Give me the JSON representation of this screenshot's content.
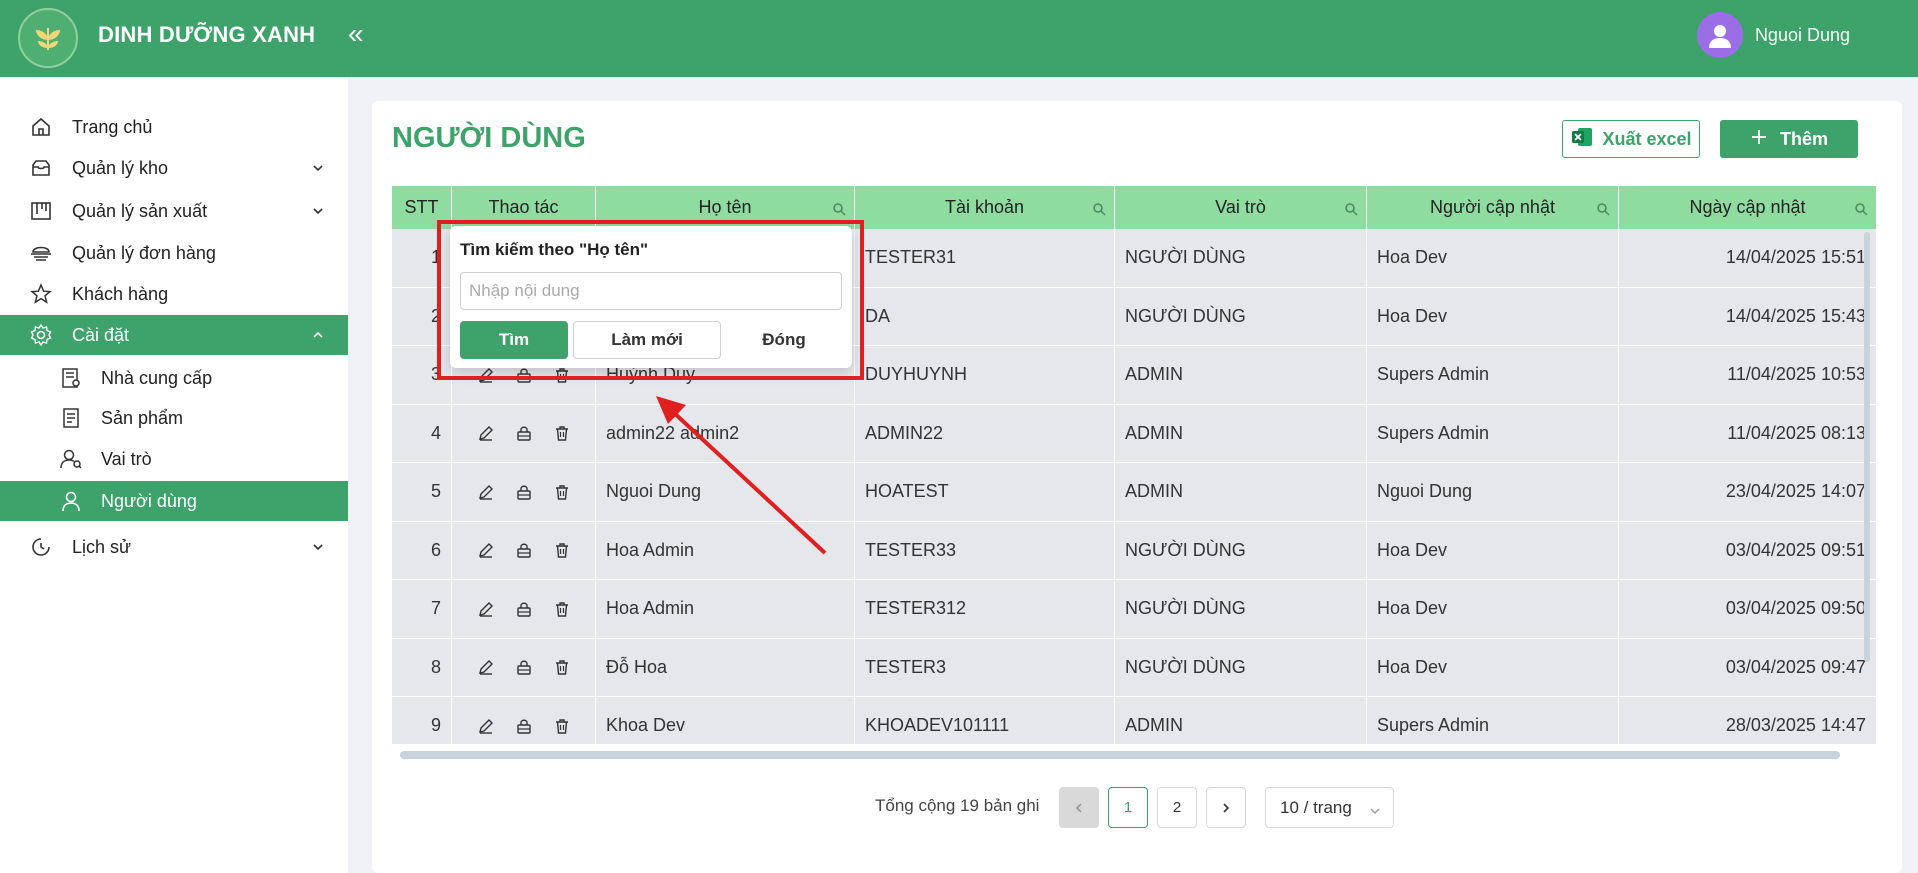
{
  "header": {
    "brand": "DINH DƯỠNG XANH",
    "collapse_icon": "double-chevron-left",
    "user_name": "Nguoi Dung",
    "colors": {
      "primary": "#3da36a",
      "avatar": "#9b6ee8"
    }
  },
  "sidebar": {
    "items": [
      {
        "label": "Trang chủ",
        "icon": "home-icon"
      },
      {
        "label": "Quản lý kho",
        "icon": "inbox-icon",
        "expandable": true
      },
      {
        "label": "Quản lý sản xuất",
        "icon": "factory-icon",
        "expandable": true
      },
      {
        "label": "Quản lý đơn hàng",
        "icon": "order-icon"
      },
      {
        "label": "Khách hàng",
        "icon": "star-icon"
      },
      {
        "label": "Cài đặt",
        "icon": "gear-icon",
        "expanded": true,
        "active": true
      },
      {
        "label": "Nhà cung cấp",
        "icon": "supplier-icon",
        "sub": true
      },
      {
        "label": "Sản phẩm",
        "icon": "product-icon",
        "sub": true
      },
      {
        "label": "Vai trò",
        "icon": "roles-icon",
        "sub": true
      },
      {
        "label": "Người dùng",
        "icon": "user-icon",
        "sub": true,
        "active": true
      },
      {
        "label": "Lịch sử",
        "icon": "history-icon",
        "expandable": true
      }
    ]
  },
  "main": {
    "title": "NGƯỜI DÙNG",
    "export_label": "Xuất excel",
    "add_label": "Thêm"
  },
  "table": {
    "columns": [
      "STT",
      "Thao tác",
      "Họ tên",
      "Tài khoản",
      "Vai trò",
      "Người cập nhật",
      "Ngày cập nhật"
    ],
    "rows": [
      {
        "stt": "1",
        "name": "",
        "account": "TESTER31",
        "role": "NGƯỜI DÙNG",
        "updated_by": "Hoa Dev",
        "updated_at": "14/04/2025 15:51"
      },
      {
        "stt": "2",
        "name": "",
        "account": "DA",
        "role": "NGƯỜI DÙNG",
        "updated_by": "Hoa Dev",
        "updated_at": "14/04/2025 15:43"
      },
      {
        "stt": "3",
        "name": "Huỳnh Duy",
        "account": "DUYHUYNH",
        "role": "ADMIN",
        "updated_by": "Supers Admin",
        "updated_at": "11/04/2025 10:53"
      },
      {
        "stt": "4",
        "name": "admin22 admin2",
        "account": "ADMIN22",
        "role": "ADMIN",
        "updated_by": "Supers Admin",
        "updated_at": "11/04/2025 08:13"
      },
      {
        "stt": "5",
        "name": "Nguoi Dung",
        "account": "HOATEST",
        "role": "ADMIN",
        "updated_by": "Nguoi Dung",
        "updated_at": "23/04/2025 14:07"
      },
      {
        "stt": "6",
        "name": "Hoa Admin",
        "account": "TESTER33",
        "role": "NGƯỜI DÙNG",
        "updated_by": "Hoa Dev",
        "updated_at": "03/04/2025 09:51"
      },
      {
        "stt": "7",
        "name": "Hoa Admin",
        "account": "TESTER312",
        "role": "NGƯỜI DÙNG",
        "updated_by": "Hoa Dev",
        "updated_at": "03/04/2025 09:50"
      },
      {
        "stt": "8",
        "name": "Đỗ Hoa",
        "account": "TESTER3",
        "role": "NGƯỜI DÙNG",
        "updated_by": "Hoa Dev",
        "updated_at": "03/04/2025 09:47"
      },
      {
        "stt": "9",
        "name": "Khoa Dev",
        "account": "KHOADEV101111",
        "role": "ADMIN",
        "updated_by": "Supers Admin",
        "updated_at": "28/03/2025 14:47"
      }
    ]
  },
  "filter_popup": {
    "title": "Tìm kiếm theo \"Họ tên\"",
    "placeholder": "Nhập nội dung",
    "value": "",
    "find_label": "Tìm",
    "reset_label": "Làm mới",
    "close_label": "Đóng"
  },
  "pagination": {
    "total": "Tổng cộng 19 bản ghi",
    "pages": [
      "1",
      "2"
    ],
    "current": "1",
    "page_size": "10 / trang"
  }
}
